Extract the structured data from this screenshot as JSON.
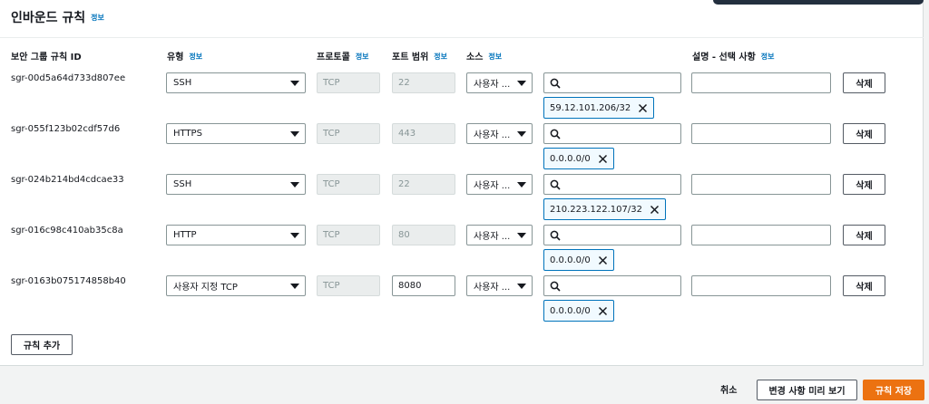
{
  "section": {
    "title": "인바운드 규칙",
    "info": "정보"
  },
  "columns": {
    "rule_id": "보안 그룹 규칙 ID",
    "type": "유형",
    "type_info": "정보",
    "protocol": "프로토콜",
    "protocol_info": "정보",
    "port": "포트 범위",
    "port_info": "정보",
    "source": "소스",
    "source_info": "정보",
    "description": "설명 - 선택 사항",
    "description_info": "정보"
  },
  "rules": [
    {
      "id": "sgr-00d5a64d733d807ee",
      "type": "SSH",
      "protocol": "TCP",
      "port": "22",
      "source": "사용자 ...",
      "cidr": "59.12.101.206/32",
      "delete": "삭제"
    },
    {
      "id": "sgr-055f123b02cdf57d6",
      "type": "HTTPS",
      "protocol": "TCP",
      "port": "443",
      "source": "사용자 ...",
      "cidr": "0.0.0.0/0",
      "delete": "삭제"
    },
    {
      "id": "sgr-024b214bd4cdcae33",
      "type": "SSH",
      "protocol": "TCP",
      "port": "22",
      "source": "사용자 ...",
      "cidr": "210.223.122.107/32",
      "delete": "삭제"
    },
    {
      "id": "sgr-016c98c410ab35c8a",
      "type": "HTTP",
      "protocol": "TCP",
      "port": "80",
      "source": "사용자 ...",
      "cidr": "0.0.0.0/0",
      "delete": "삭제"
    },
    {
      "id": "sgr-0163b075174858b40",
      "type": "사용자 지정 TCP",
      "protocol": "TCP",
      "port": "8080",
      "source": "사용자 ...",
      "cidr": "0.0.0.0/0",
      "delete": "삭제"
    }
  ],
  "actions": {
    "add_rule": "규칙 추가",
    "cancel": "취소",
    "preview": "변경 사항 미리 보기",
    "save": "규칙 저장"
  },
  "colors": {
    "accent": "#ec7211",
    "link": "#0073bb",
    "token_border": "#0073bb"
  },
  "icons": {
    "search": "search-icon",
    "remove": "close-icon",
    "dropdown": "caret-down-icon"
  }
}
